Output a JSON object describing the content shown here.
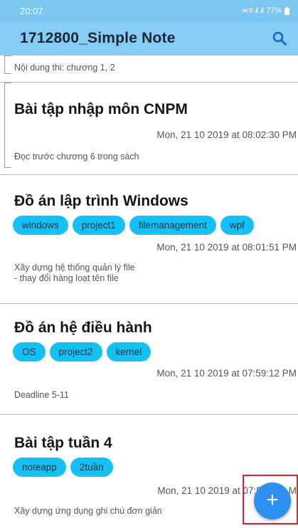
{
  "status_bar": {
    "time": "20:07",
    "signal": "»ı ≡ .ıl .ıl",
    "battery": "77%"
  },
  "app_bar": {
    "title": "1712800_Simple Note"
  },
  "notes": [
    {
      "content": "Nội dung thi: chương 1, 2"
    },
    {
      "title": "Bài tập nhập môn CNPM",
      "date": "Mon, 21 10 2019 at 08:02:30 PM",
      "content": "Đọc trước chương 6 trong sách"
    },
    {
      "title": "Đồ án lập trình Windows",
      "tags": [
        "windows",
        "project1",
        "filemanagement",
        "wpf"
      ],
      "date": "Mon, 21 10 2019 at 08:01:51 PM",
      "content": "Xây dựng hệ thống quản lý file\n- thay đổi hàng loạt tên file"
    },
    {
      "title": "Đồ án hệ điều hành",
      "tags": [
        "OS",
        "project2",
        "kernel"
      ],
      "date": "Mon, 21 10 2019 at 07:59:12 PM",
      "content": "Deadline 5-11"
    },
    {
      "title": "Bài tập tuần 4",
      "tags": [
        "noteapp",
        "2tuần"
      ],
      "date": "Mon, 21 10 2019 at 07:5",
      "date_tail": "M",
      "content": "Xây dựng ứng dụng ghi chú đơn giản"
    }
  ],
  "fab": {
    "label": "+"
  },
  "colors": {
    "app_bar": "#86cdf5",
    "tag": "#13c1f5",
    "fab": "#2f8ff0",
    "highlight": "#e0202a"
  },
  "icons": {
    "search": "search-icon",
    "add": "plus-icon",
    "wifi": "wifi-icon",
    "battery": "battery-icon"
  }
}
